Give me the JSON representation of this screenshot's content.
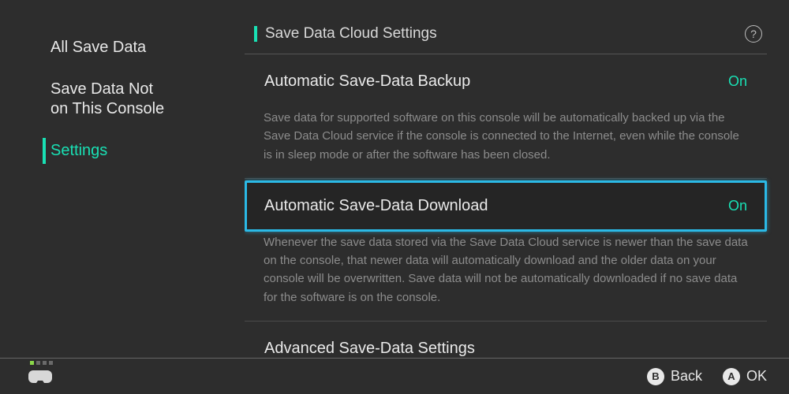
{
  "sidebar": {
    "items": [
      {
        "label": "All Save Data",
        "selected": false
      },
      {
        "label": "Save Data Not\non This Console",
        "selected": false
      },
      {
        "label": "Settings",
        "selected": true
      }
    ]
  },
  "section": {
    "title": "Save Data Cloud Settings",
    "help_glyph": "?"
  },
  "settings": [
    {
      "label": "Automatic Save-Data Backup",
      "value": "On",
      "focused": false,
      "description": "Save data for supported software on this console will be automatically backed up via the Save Data Cloud service if the console is connected to the Internet, even while the console is in sleep mode or after the software has been closed."
    },
    {
      "label": "Automatic Save-Data Download",
      "value": "On",
      "focused": true,
      "description": "Whenever the save data stored via the Save Data Cloud service is newer than the save data on the console, that newer data will automatically download and the older data on your console will be overwritten. Save data will not be automatically downloaded if no save data for the software is on the console."
    },
    {
      "label": "Advanced Save-Data Settings",
      "value": "",
      "focused": false,
      "description": ""
    }
  ],
  "footer": {
    "back": {
      "glyph": "B",
      "label": "Back"
    },
    "ok": {
      "glyph": "A",
      "label": "OK"
    }
  },
  "colors": {
    "accent": "#19e0b4",
    "focus": "#2bb9e6",
    "bg": "#2d2d2d"
  }
}
